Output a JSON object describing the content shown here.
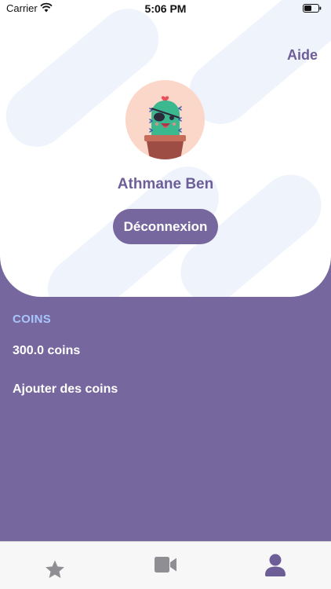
{
  "status_bar": {
    "carrier": "Carrier",
    "time": "5:06 PM"
  },
  "header": {
    "help_label": "Aide"
  },
  "profile": {
    "name": "Athmane Ben",
    "logout_label": "Déconnexion",
    "avatar_icon": "cactus-pirate-avatar"
  },
  "coins": {
    "heading": "COINS",
    "balance": "300.0 coins",
    "add_label": "Ajouter des coins"
  },
  "tabbar": {
    "tabs": [
      {
        "icon": "star-icon",
        "selected": false
      },
      {
        "icon": "video-camera-icon",
        "selected": false
      },
      {
        "icon": "user-icon",
        "selected": true
      }
    ]
  },
  "colors": {
    "primary": "#77679f",
    "accent_text": "#6d5e98",
    "coins_heading": "#a7c6fb",
    "stripe": "#eef3fc",
    "tab_inactive": "#8e8e93"
  }
}
